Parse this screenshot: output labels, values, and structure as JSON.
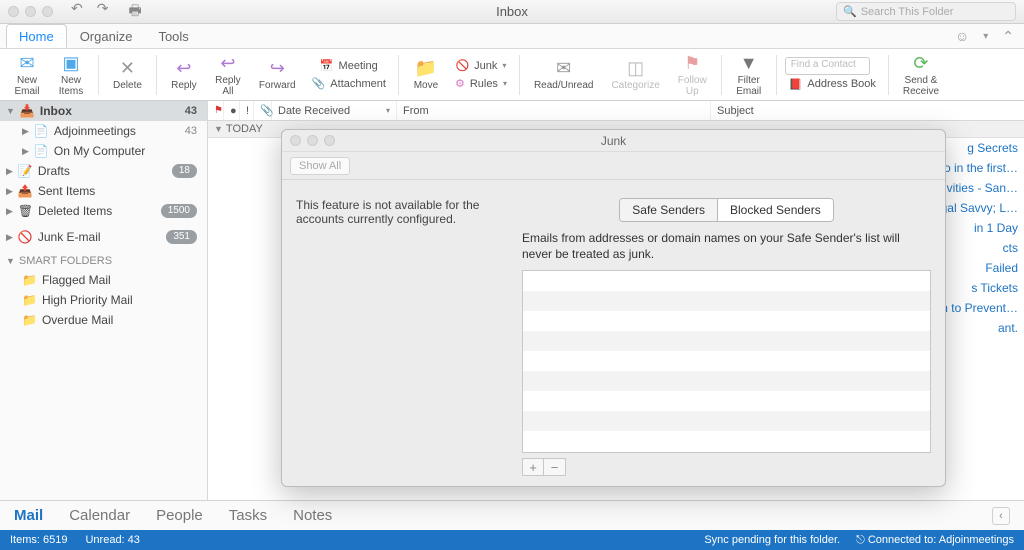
{
  "window": {
    "title": "Inbox",
    "searchPlaceholder": "Search This Folder"
  },
  "tabs": {
    "home": "Home",
    "organize": "Organize",
    "tools": "Tools"
  },
  "ribbon": {
    "newEmail": "New\nEmail",
    "newItems": "New\nItems",
    "delete": "Delete",
    "reply": "Reply",
    "replyAll": "Reply\nAll",
    "forward": "Forward",
    "meeting": "Meeting",
    "attachment": "Attachment",
    "move": "Move",
    "junk": "Junk",
    "rules": "Rules",
    "readUnread": "Read/Unread",
    "categorize": "Categorize",
    "followUp": "Follow\nUp",
    "filterEmail": "Filter\nEmail",
    "findPlaceholder": "Find a Contact",
    "addressBook": "Address Book",
    "sendReceive": "Send &\nReceive"
  },
  "sidebar": {
    "inbox": "Inbox",
    "inboxCount": "43",
    "adjoin": "Adjoinmeetings",
    "adjoinCount": "43",
    "onmy": "On My Computer",
    "drafts": "Drafts",
    "draftsBadge": "18",
    "sent": "Sent Items",
    "deleted": "Deleted Items",
    "deletedBadge": "1500",
    "junk": "Junk E-mail",
    "junkBadge": "351",
    "smart": "SMART FOLDERS",
    "flagged": "Flagged Mail",
    "high": "High Priority Mail",
    "overdue": "Overdue Mail"
  },
  "columns": {
    "dateReceived": "Date Received",
    "from": "From",
    "subject": "Subject"
  },
  "listgroup": "TODAY",
  "subjects": [
    "g Secrets",
    "zero in the first…",
    "Activities - San…",
    "",
    "",
    "",
    "r Legal Savvy; L…",
    "",
    "in 1 Day",
    "cts",
    "Failed",
    "s Tickets",
    "Tech to Prevent…",
    "ant."
  ],
  "dialog": {
    "title": "Junk",
    "showAll": "Show All",
    "leftMsg": "This feature is not available for the accounts currently configured.",
    "tabSafe": "Safe Senders",
    "tabBlocked": "Blocked Senders",
    "help": "Emails from addresses or domain names on your Safe Sender's list will never be treated as junk."
  },
  "bottom": {
    "mail": "Mail",
    "calendar": "Calendar",
    "people": "People",
    "tasks": "Tasks",
    "notes": "Notes"
  },
  "status": {
    "items": "Items: 6519",
    "unread": "Unread: 43",
    "sync": "Sync pending for this folder.",
    "connected": "Connected to: Adjoinmeetings"
  }
}
